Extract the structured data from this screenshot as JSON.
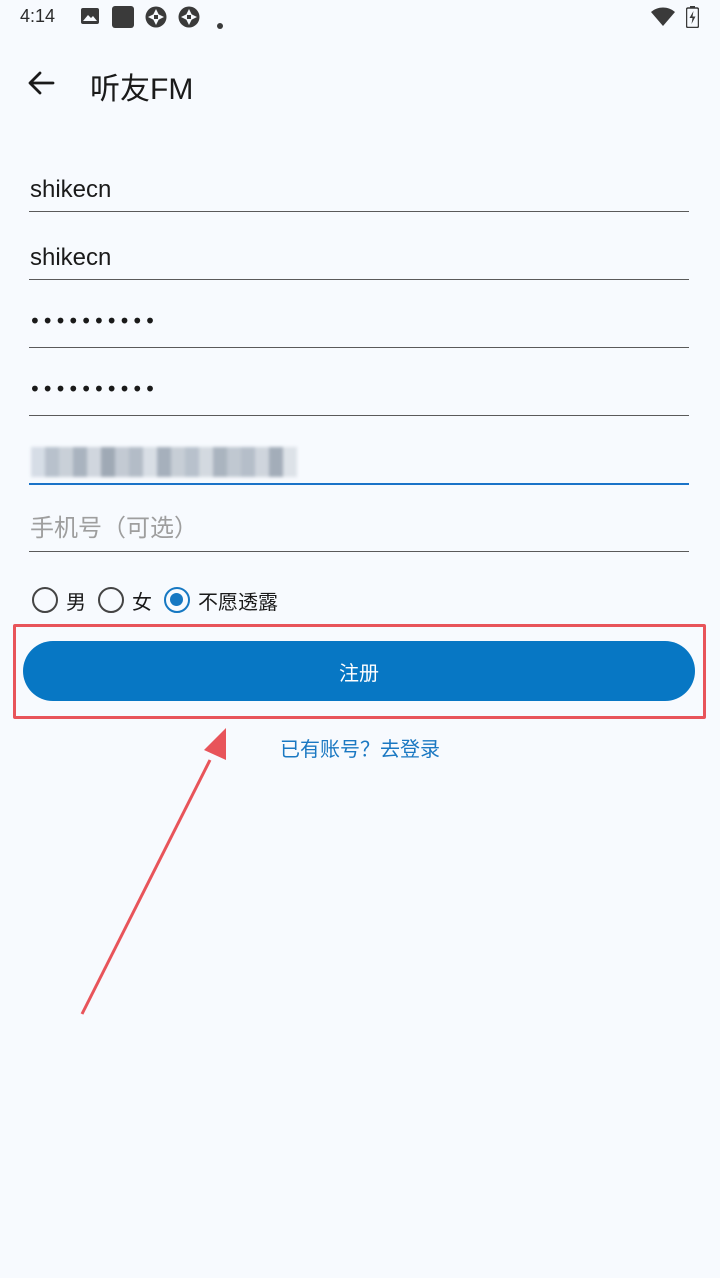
{
  "status_bar": {
    "time": "4:14",
    "icons": [
      "photo-icon",
      "square-icon",
      "aperture-icon",
      "aperture-icon",
      "dot-icon",
      "wifi-icon",
      "battery-charging-icon"
    ]
  },
  "app_bar": {
    "back_icon": "arrow-left-icon",
    "title": "听友FM"
  },
  "form": {
    "username": {
      "value": "shikecn"
    },
    "nickname": {
      "value": "shikecn"
    },
    "password": {
      "value": "••••••••••"
    },
    "confirm_password": {
      "value": "••••••••••"
    },
    "email": {
      "value_redacted": true
    },
    "phone": {
      "value": "",
      "placeholder": "手机号（可选）"
    }
  },
  "gender": {
    "options": [
      {
        "label": "男",
        "checked": false
      },
      {
        "label": "女",
        "checked": false
      },
      {
        "label": "不愿透露",
        "checked": true
      }
    ]
  },
  "actions": {
    "register_label": "注册",
    "login_link": "已有账号？去登录"
  },
  "colors": {
    "background": "#f7fafe",
    "primary": "#0777c4",
    "link": "#1a78c2",
    "annotation": "#e8545a"
  }
}
